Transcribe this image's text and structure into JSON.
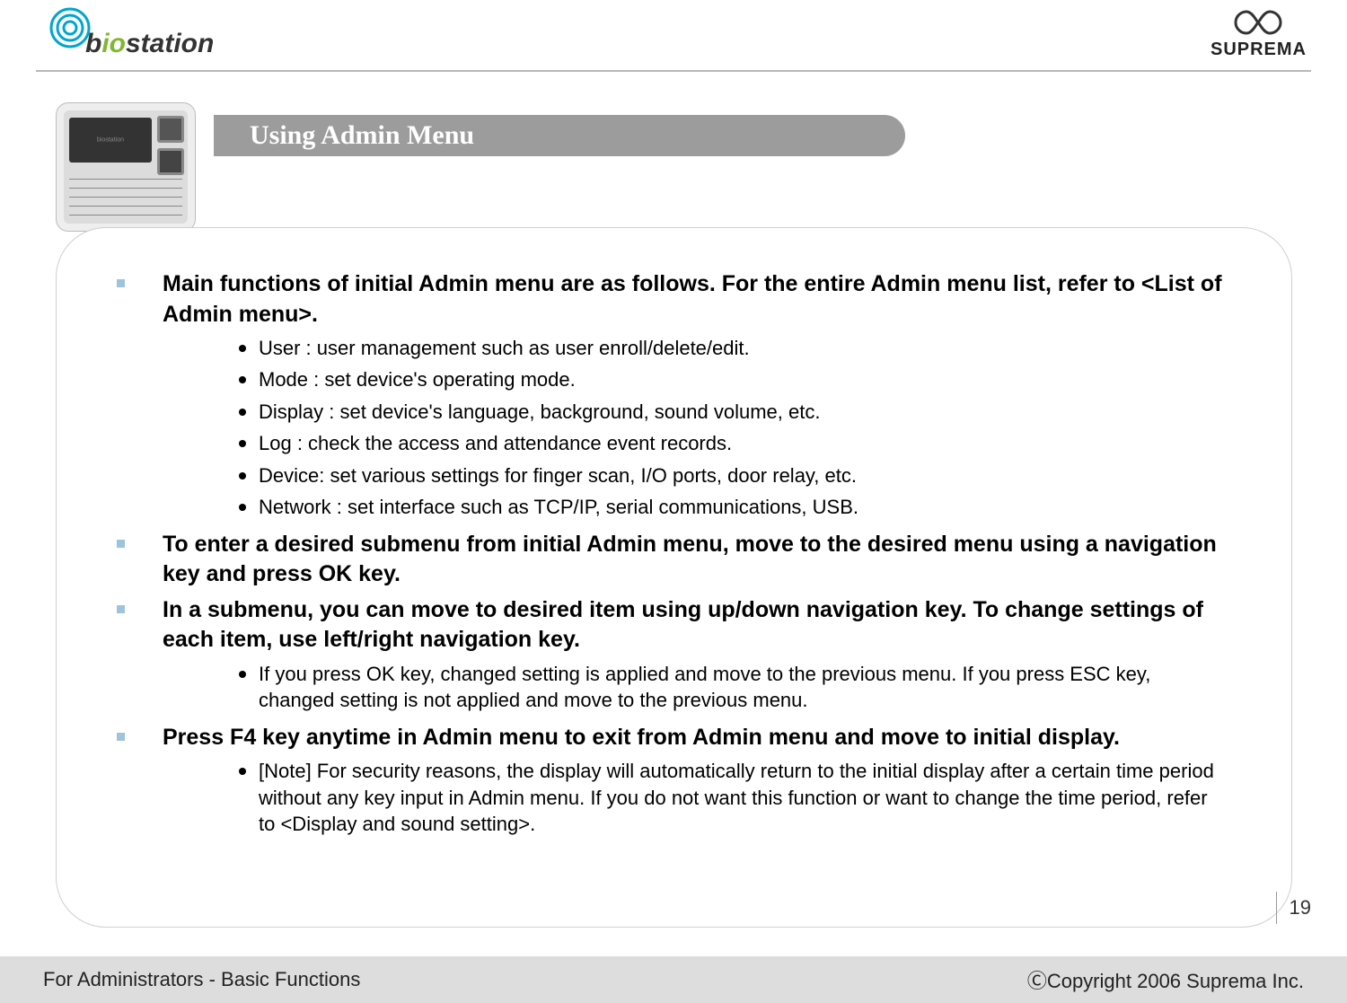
{
  "header": {
    "biostation_prefix": "b",
    "biostation_mid": "io",
    "biostation_suffix": "station",
    "suprema": "SUPREMA"
  },
  "title": "Using Admin Menu",
  "sections": [
    {
      "main": "Main functions of initial Admin menu are as follows. For the entire Admin menu list, refer to <List of Admin menu>.",
      "subs": [
        "User : user management such as user enroll/delete/edit.",
        "Mode : set device's operating mode.",
        "Display : set device's language, background, sound volume, etc.",
        "Log : check the access and attendance event records.",
        "Device: set various settings for finger scan, I/O ports, door relay, etc.",
        "Network : set interface such as TCP/IP, serial communications, USB."
      ]
    },
    {
      "main": "To enter a desired submenu from initial Admin menu, move to the desired menu using a navigation key and press OK key.",
      "subs": []
    },
    {
      "main": "In a submenu, you can move to desired item using up/down navigation key. To change settings of each item, use left/right navigation key.",
      "subs": [
        "If you press OK key, changed setting is applied and move to the previous menu. If you press ESC key, changed setting is not applied and move to the previous menu."
      ]
    },
    {
      "main": "Press F4 key anytime in Admin menu to exit from Admin menu and move to initial display.",
      "subs": [
        "[Note] For security reasons, the display will automatically return to the initial display after a certain time period without any key input in Admin menu. If you do not want this function or want to change the time period, refer to <Display and sound setting>."
      ]
    }
  ],
  "page_number": "19",
  "footer": {
    "left": "For Administrators - Basic Functions",
    "right": "ⒸCopyright 2006 Suprema Inc."
  }
}
